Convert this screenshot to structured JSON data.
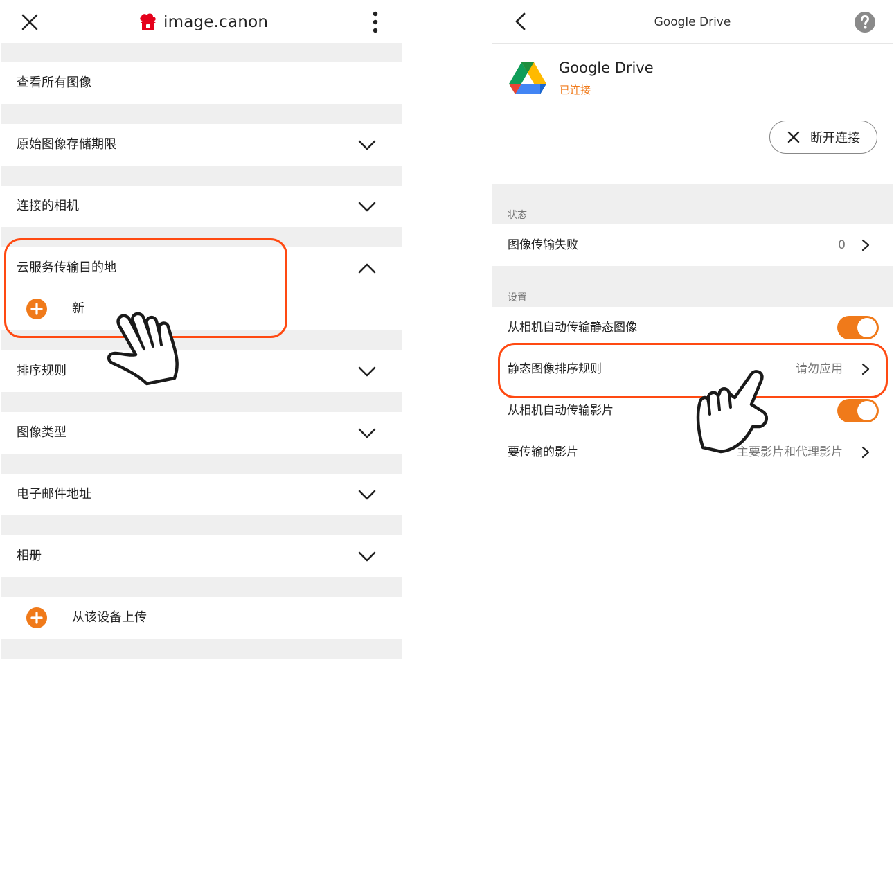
{
  "left": {
    "brand": "image.canon",
    "rows": [
      {
        "label": "查看所有图像"
      },
      {
        "label": "原始图像存储期限"
      },
      {
        "label": "连接的相机"
      },
      {
        "label": "云服务传输目的地"
      },
      {
        "label": "排序规则"
      },
      {
        "label": "图像类型"
      },
      {
        "label": "电子邮件地址"
      },
      {
        "label": "相册"
      }
    ],
    "new_label": "新",
    "upload_label": "从该设备上传"
  },
  "right": {
    "title": "Google Drive",
    "service_name": "Google Drive",
    "service_status": "已连接",
    "disconnect_label": "断开连接",
    "status_section": "状态",
    "failed_label": "图像传输失败",
    "failed_count": "0",
    "settings_section": "设置",
    "auto_still_label": "从相机自动传输静态图像",
    "sort_rule_label": "静态图像排序规则",
    "sort_rule_value": "请勿应用",
    "auto_movie_label": "从相机自动传输影片",
    "movies_label": "要传输的影片",
    "movies_value": "主要影片和代理影片"
  },
  "colors": {
    "accent": "#f07a1a",
    "highlight": "#ff4a12",
    "gap": "#efefef"
  },
  "icons": [
    "close-icon",
    "image-canon-logo",
    "more-vertical-icon",
    "chevron-down-icon",
    "chevron-up-icon",
    "plus-circle-icon",
    "hand-pointer-icon",
    "back-icon",
    "help-icon",
    "google-drive-logo",
    "chevron-right-icon",
    "toggle-switch"
  ]
}
